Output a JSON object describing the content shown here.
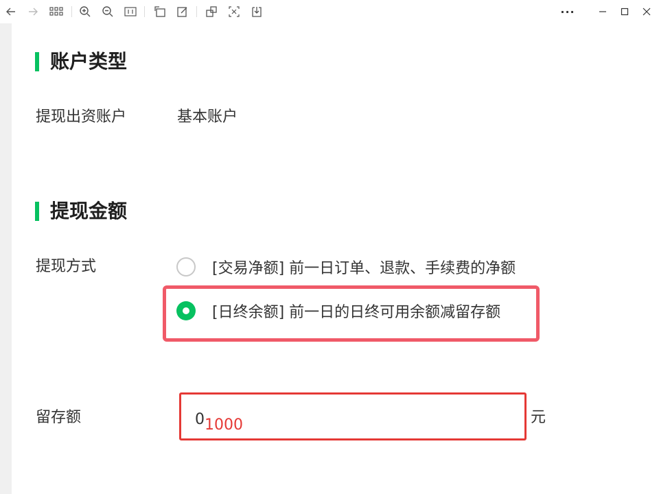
{
  "toolbar": {
    "icons": [
      "back-icon",
      "forward-icon",
      "grid-icon",
      "zoom-in-icon",
      "zoom-out-icon",
      "actual-size-icon",
      "rotate-icon",
      "edit-icon",
      "ocr-icon",
      "crop-icon",
      "download-icon"
    ],
    "more_label": "···",
    "window_controls": [
      "minimize-icon",
      "maximize-icon",
      "close-icon"
    ]
  },
  "account_section": {
    "title": "账户类型",
    "source_label": "提现出资账户",
    "source_value": "基本账户"
  },
  "amount_section": {
    "title": "提现金额",
    "method_label": "提现方式",
    "options": [
      {
        "label": "[交易净额] 前一日订单、退款、手续费的净额",
        "checked": false
      },
      {
        "label": "[日终余额] 前一日的日终可用余额减留存额",
        "checked": true
      }
    ],
    "reserve_label": "留存额",
    "reserve_value_original": "0",
    "reserve_value_new": "1000",
    "unit": "元"
  },
  "colors": {
    "accent_green": "#07c160",
    "highlight_red": "#f05a68",
    "input_red": "#e53935"
  }
}
